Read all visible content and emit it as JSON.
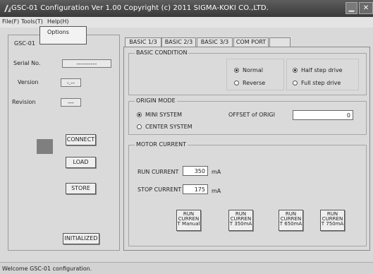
{
  "window": {
    "title": "GSC-01 Configuration  Ver 1.00  Copyright (c) 2011  SIGMA-KOKI CO.,LTD.",
    "min_icon": "minimize-icon",
    "close_icon": "close-icon"
  },
  "menu": {
    "file": "File(F)",
    "tools": "Tools(T)",
    "help": "Help(H)",
    "tools_items": [
      "Options"
    ]
  },
  "left_panel": {
    "group_title": "GSC-01",
    "serial_label": "Serial No.",
    "serial_value": "----------",
    "version_label": "Version",
    "version_value": "-.--",
    "revision_label": "Revision",
    "revision_value": "---",
    "connect": "CONNECT",
    "load": "LOAD",
    "store": "STORE",
    "initialized": "INITIALIZED"
  },
  "tabs": [
    "BASIC 1/3",
    "BASIC 2/3",
    "BASIC 3/3",
    "COM PORT",
    ""
  ],
  "basic_condition": {
    "title": "BASIC CONDITION",
    "normal": "Normal",
    "reverse": "Reverse",
    "half_step": "Half step drive",
    "full_step": "Full step drive"
  },
  "origin_mode": {
    "title": "ORIGIN MODE",
    "mini": "MINI SYSTEM",
    "center": "CENTER SYSTEM",
    "offset_label": "OFFSET of ORIGI",
    "offset_value": "0"
  },
  "motor_current": {
    "title": "MOTOR CURRENT",
    "run_label": "RUN CURRENT",
    "run_value": "350",
    "run_unit": "mA",
    "stop_label": "STOP CURRENT",
    "stop_value": "175",
    "stop_unit": "mA",
    "buttons": [
      {
        "l1": "RUN",
        "l2": "CURREN",
        "l3": "T Manual"
      },
      {
        "l1": "RUN",
        "l2": "CURREN",
        "l3": "T 350mA"
      },
      {
        "l1": "RUN",
        "l2": "CURREN",
        "l3": "T 650mA"
      },
      {
        "l1": "RUN",
        "l2": "CURREN",
        "l3": "T 750mA"
      }
    ]
  },
  "status": "Welcome GSC-01 configuration."
}
